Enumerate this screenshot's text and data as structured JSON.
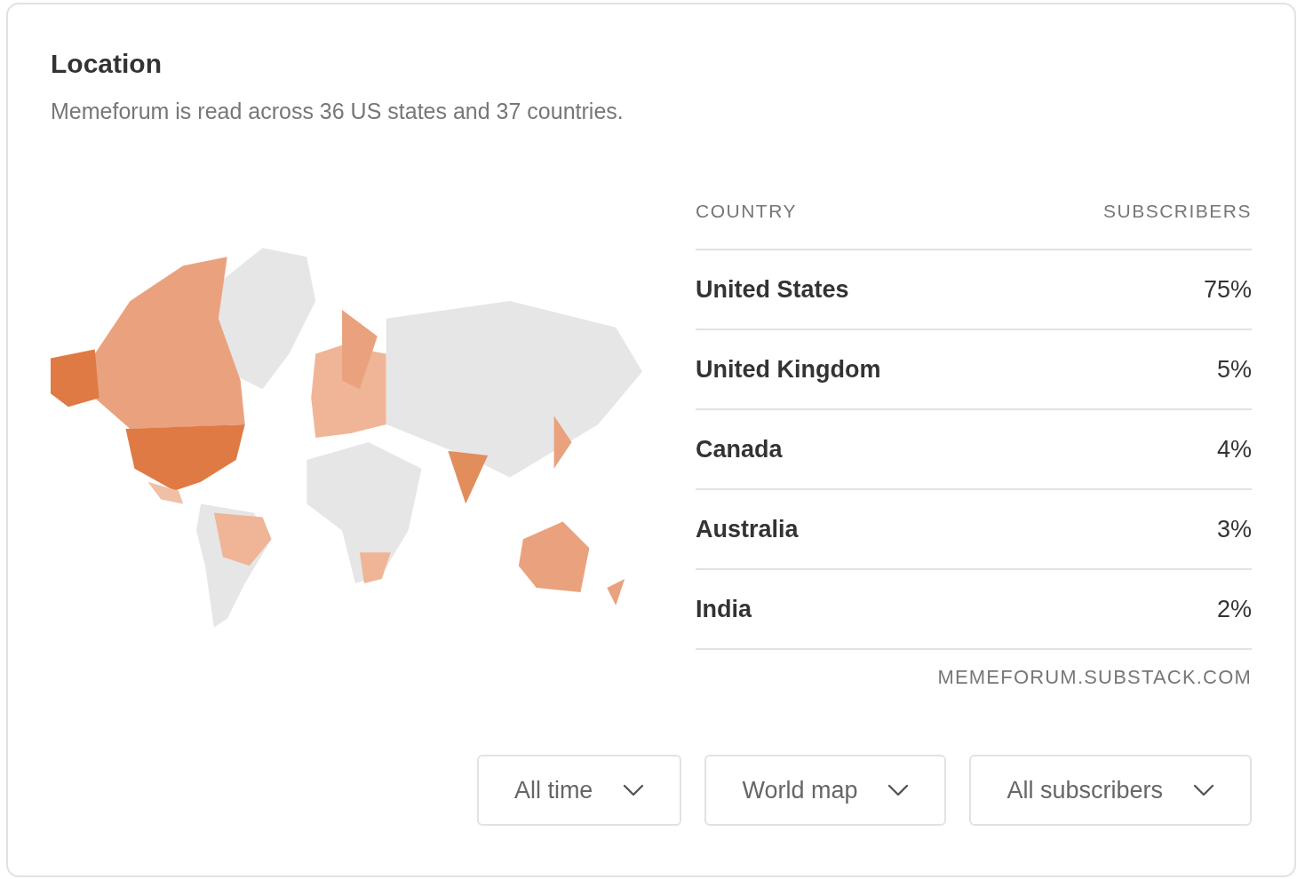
{
  "title": "Location",
  "subtitle": "Memeforum is read across 36 US states and 37 countries.",
  "table": {
    "columns": [
      "COUNTRY",
      "SUBSCRIBERS"
    ],
    "rows": [
      {
        "country": "United States",
        "share": "75%"
      },
      {
        "country": "United Kingdom",
        "share": "5%"
      },
      {
        "country": "Canada",
        "share": "4%"
      },
      {
        "country": "Australia",
        "share": "3%"
      },
      {
        "country": "India",
        "share": "2%"
      }
    ]
  },
  "source": "MEMEFORUM.SUBSTACK.COM",
  "filters": [
    "All time",
    "World map",
    "All subscribers"
  ]
}
